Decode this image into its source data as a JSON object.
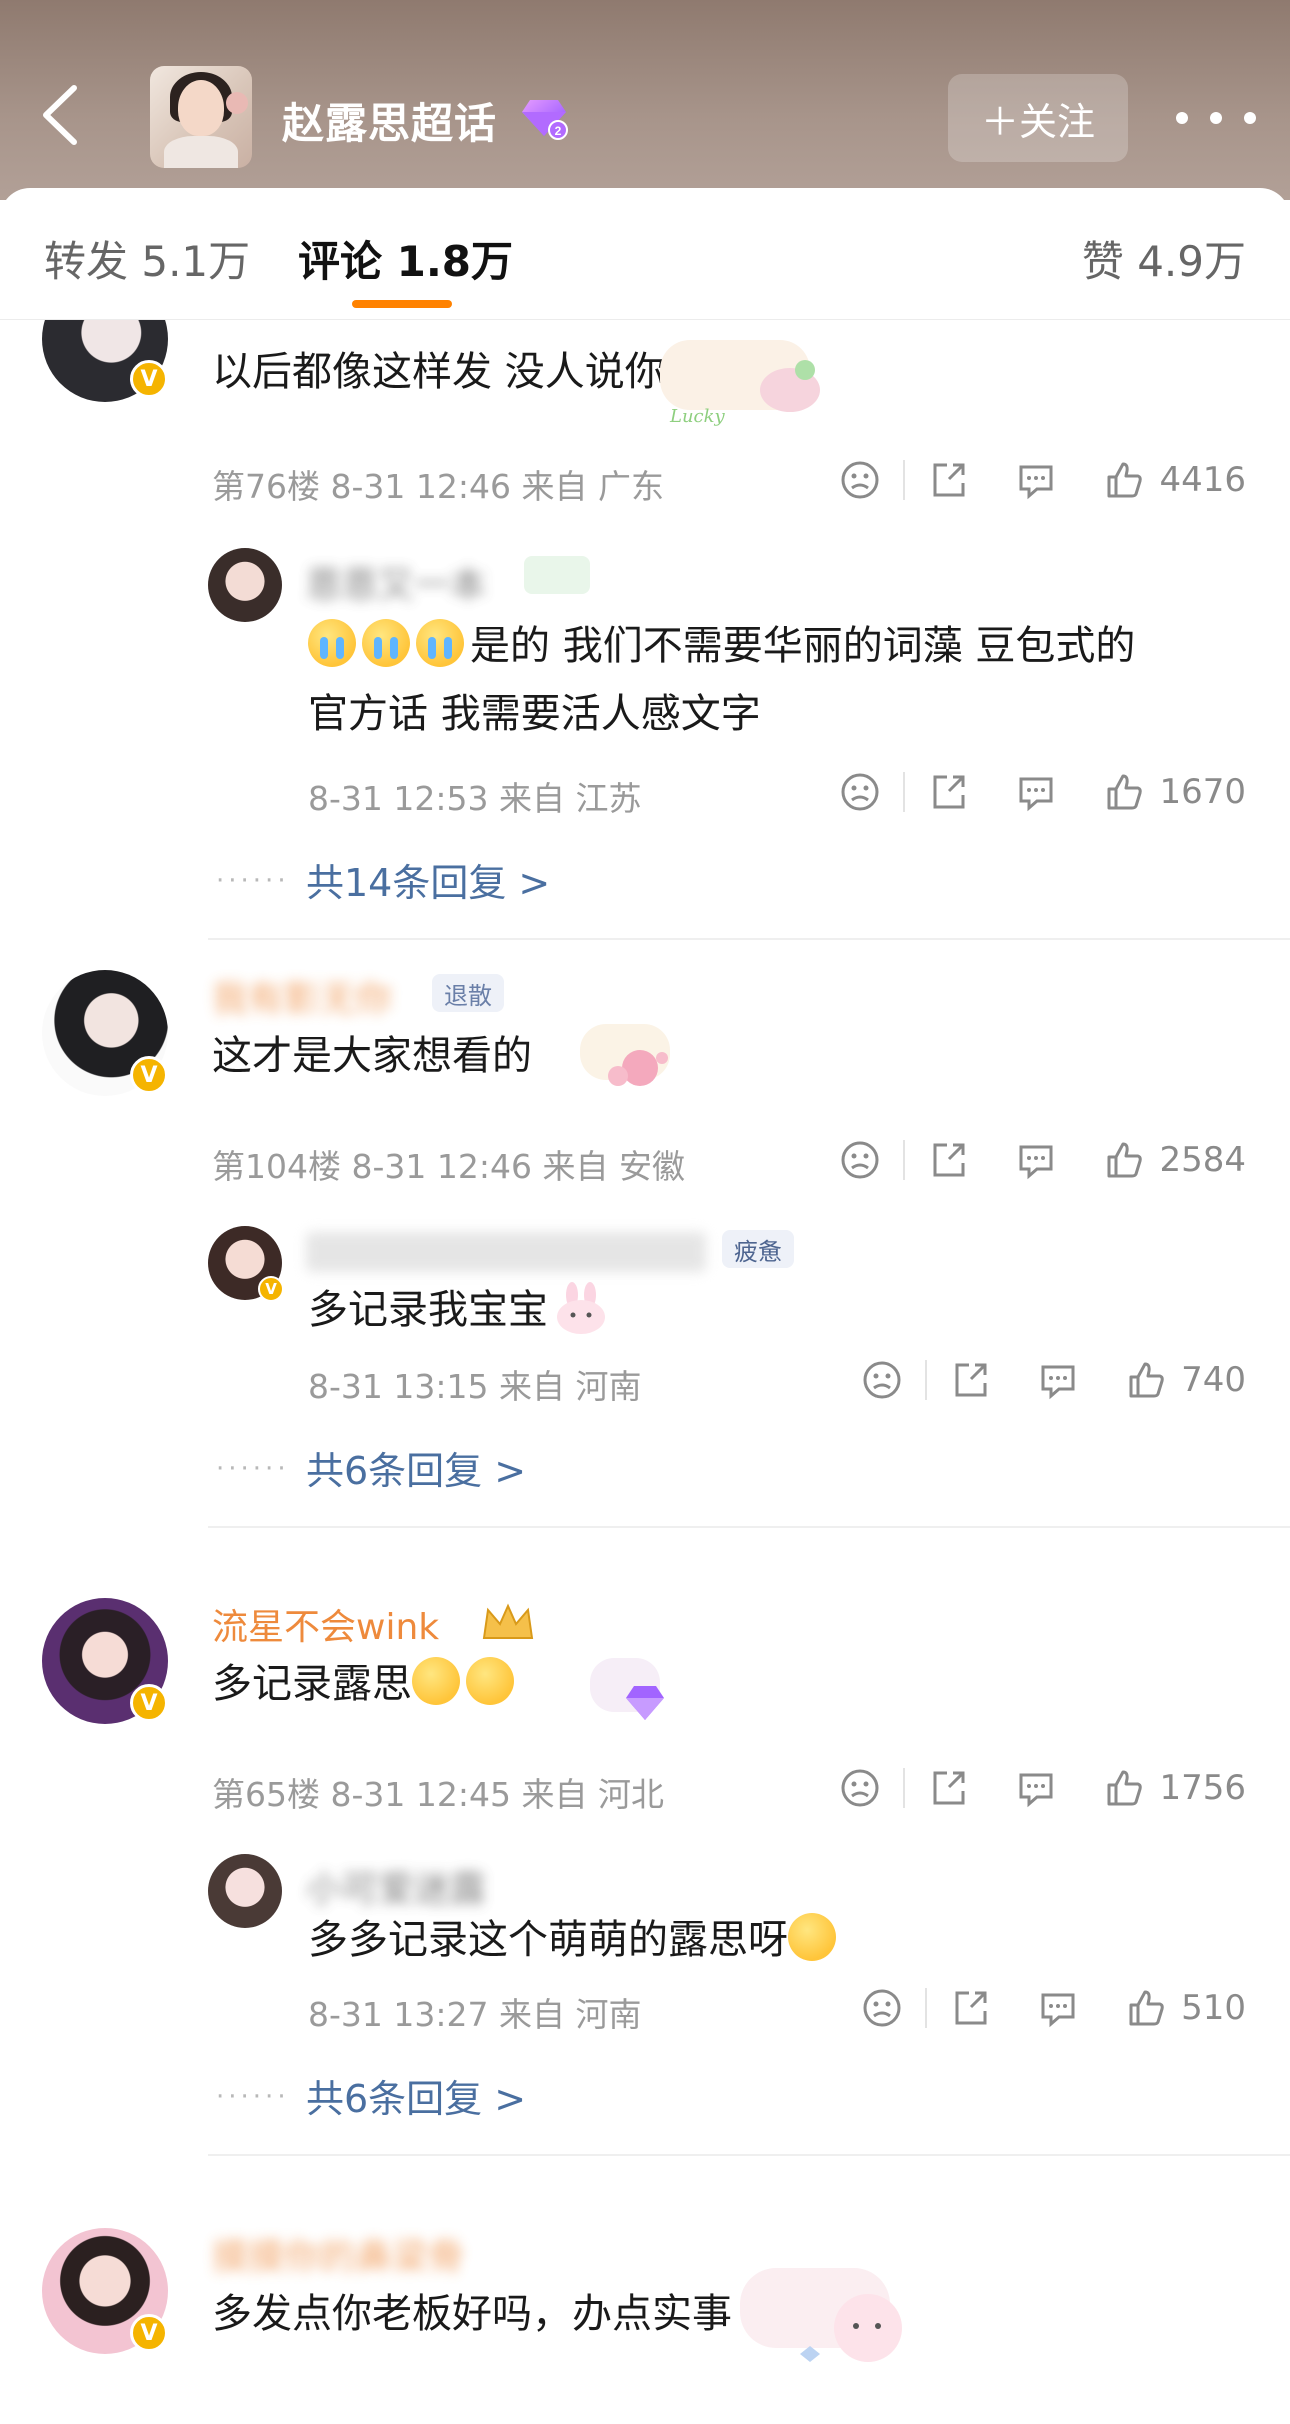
{
  "header": {
    "title": "赵露思超话",
    "follow_label": "＋关注"
  },
  "tabs": {
    "repost": "转发 5.1万",
    "comment": "评论 1.8万",
    "like": "赞 4.9万"
  },
  "comments": [
    {
      "text": "以后都像这样发 没人说你",
      "meta": "第76楼 8-31 12:46 来自 广东",
      "likes": "4416",
      "reply": {
        "username": "恩恩又一本",
        "text_line1": "是的 我们不需要华丽的词藻 豆包式的",
        "text_line2": "官方话 我需要活人感文字",
        "meta": "8-31 12:53 来自 江苏",
        "likes": "1670"
      },
      "more_replies": "共14条回复 >"
    },
    {
      "username": "我有影无你",
      "tag": "退散",
      "text": "这才是大家想看的",
      "meta": "第104楼 8-31 12:46 来自 安徽",
      "likes": "2584",
      "reply": {
        "username": "",
        "tag": "疲惫",
        "text": "多记录我宝宝",
        "meta": "8-31 13:15 来自 河南",
        "likes": "740"
      },
      "more_replies": "共6条回复 >"
    },
    {
      "username": "流星不会wink",
      "text": "多记录露思",
      "meta": "第65楼 8-31 12:45 来自 河北",
      "likes": "1756",
      "reply": {
        "username": "小可爱迷露",
        "text": "多多记录这个萌萌的露思呀",
        "meta": "8-31 13:27 来自 河南",
        "likes": "510"
      },
      "more_replies": "共6条回复 >"
    },
    {
      "username": "摸摸你的鼻梁骨",
      "text": "多发点你老板好吗，办点实事"
    }
  ],
  "icons": {
    "back": "back-arrow-icon",
    "more": "more-dots-icon",
    "dislike": "sad-face-icon",
    "share": "share-icon",
    "comment": "comment-bubble-icon",
    "like": "thumbs-up-icon"
  },
  "colors": {
    "accent": "#ff8200",
    "username": "#ee8a3c",
    "link": "#4a6fa0",
    "vip_badge": "#f5b400"
  }
}
